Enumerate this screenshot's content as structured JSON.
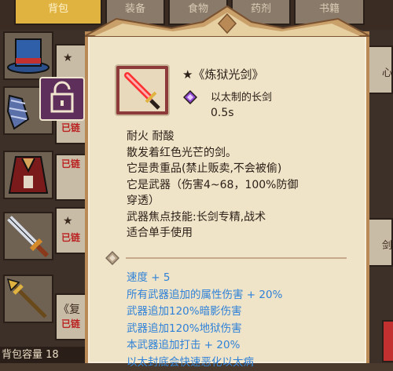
{
  "background": {
    "tabs": [
      {
        "label": "背包",
        "active": true
      },
      {
        "label": "装备",
        "active": false
      },
      {
        "label": "食物",
        "active": false
      },
      {
        "label": "药剂",
        "active": false
      },
      {
        "label": "书籍",
        "active": false
      }
    ],
    "inventory_rows": [
      {
        "icon": "top-hat-icon",
        "mark": "★"
      },
      {
        "icon": "chainmail-icon",
        "mark": "★",
        "tag": "已链"
      },
      {
        "icon": "red-cloak-icon",
        "mark": "★",
        "tag": "已链"
      },
      {
        "icon": "sword-icon",
        "mark": "★",
        "tag": "已链"
      },
      {
        "icon": "golden-spear-icon",
        "mark": "《复",
        "tag": "已链"
      }
    ],
    "right_column": [
      "心",
      "剑"
    ],
    "bottom_text": "背包容量 18",
    "lock_icon": "padlock-icon"
  },
  "tooltip": {
    "item_name": "★《炼狱光剑》",
    "item_icon": "red-lightsaber-icon",
    "material_icon": "purple-gem-icon",
    "material": "以太制的长剑",
    "speed": "0.5s",
    "description": [
      "耐火 耐酸",
      "散发着红色光芒的剑。",
      "它是贵重品(禁止贩卖,不会被偷)",
      "它是武器（伤害4~68，100%防御",
      "穿透）",
      "武器焦点技能:长剑专精,战术",
      "适合单手使用"
    ],
    "stats": [
      "速度 + 5",
      "所有武器追加的属性伤害 + 20%",
      "武器追加120%暗影伤害",
      "武器追加120%地狱伤害",
      "本武器追加打击 + 20%",
      "以太封底会快速恶化以太病"
    ],
    "colors": {
      "panel": "#efe3c8",
      "border": "#b98a55",
      "stat_text": "#2f82d8",
      "name_text": "#2c2118"
    }
  }
}
